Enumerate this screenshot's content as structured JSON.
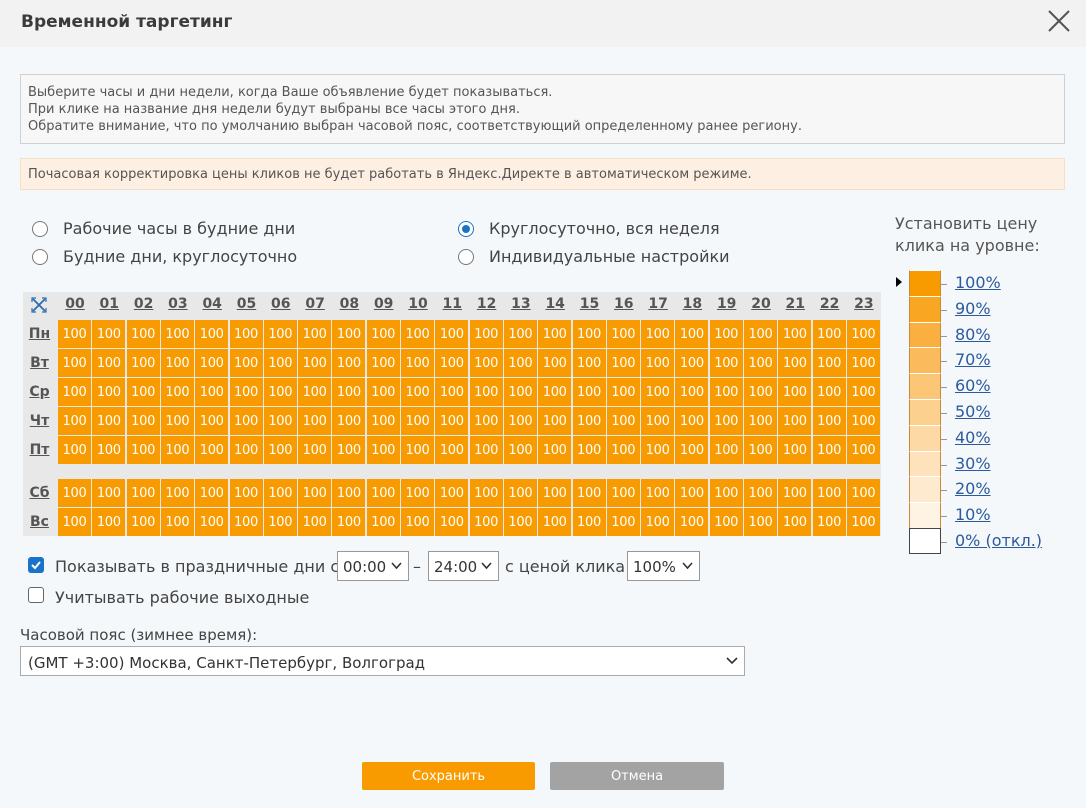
{
  "header": {
    "title": "Временной таргетинг"
  },
  "info_lines": [
    "Выберите часы и дни недели, когда Ваше объявление будет показываться.",
    "При клике на название дня недели будут выбраны все часы этого дня.",
    "Обратите внимание, что по умолчанию выбран часовой пояс, соответствующий определенному ранее региону."
  ],
  "warning": "Почасовая корректировка цены кликов не будет работать в Яндекс.Директе в автоматическом режиме.",
  "presets": {
    "workhours": "Рабочие часы в будние дни",
    "weekdays": "Будние дни, круглосуточно",
    "allweek": "Круглосуточно, вся неделя",
    "custom": "Индивидуальные настройки",
    "selected": "allweek"
  },
  "schedule": {
    "hours": [
      "00",
      "01",
      "02",
      "03",
      "04",
      "05",
      "06",
      "07",
      "08",
      "09",
      "10",
      "11",
      "12",
      "13",
      "14",
      "15",
      "16",
      "17",
      "18",
      "19",
      "20",
      "21",
      "22",
      "23"
    ],
    "days": [
      "Пн",
      "Вт",
      "Ср",
      "Чт",
      "Пт",
      "Сб",
      "Вс"
    ],
    "cell_value": "100",
    "cell_color": "#f89b00"
  },
  "holidays": {
    "show_label": "Показывать в праздничные дни с",
    "show_checked": true,
    "from": "00:00",
    "dash": "–",
    "to": "24:00",
    "price_label": "с ценой клика",
    "price": "100%",
    "workdays_label": "Учитывать рабочие выходные",
    "workdays_checked": false
  },
  "timezone": {
    "label": "Часовой пояс (зимнее время):",
    "value": "(GMT +3:00) Москва, Санкт-Петербург, Волгоград"
  },
  "legend": {
    "title": "Установить цену клика на уровне:",
    "levels": [
      {
        "label": "100%",
        "color": "#f89b00"
      },
      {
        "label": "90%",
        "color": "#f9a622"
      },
      {
        "label": "80%",
        "color": "#fab040"
      },
      {
        "label": "70%",
        "color": "#fbbb5c"
      },
      {
        "label": "60%",
        "color": "#fbc676"
      },
      {
        "label": "50%",
        "color": "#fcd08f"
      },
      {
        "label": "40%",
        "color": "#fdd9a6"
      },
      {
        "label": "30%",
        "color": "#fde2bb"
      },
      {
        "label": "20%",
        "color": "#feebcf"
      },
      {
        "label": "10%",
        "color": "#fff4e4"
      },
      {
        "label": "0% (откл.)",
        "color": "#ffffff"
      }
    ],
    "selected": "100%"
  },
  "buttons": {
    "save": "Сохранить",
    "cancel": "Отмена",
    "save_color": "#f89b00",
    "cancel_color": "#a3a3a3"
  }
}
